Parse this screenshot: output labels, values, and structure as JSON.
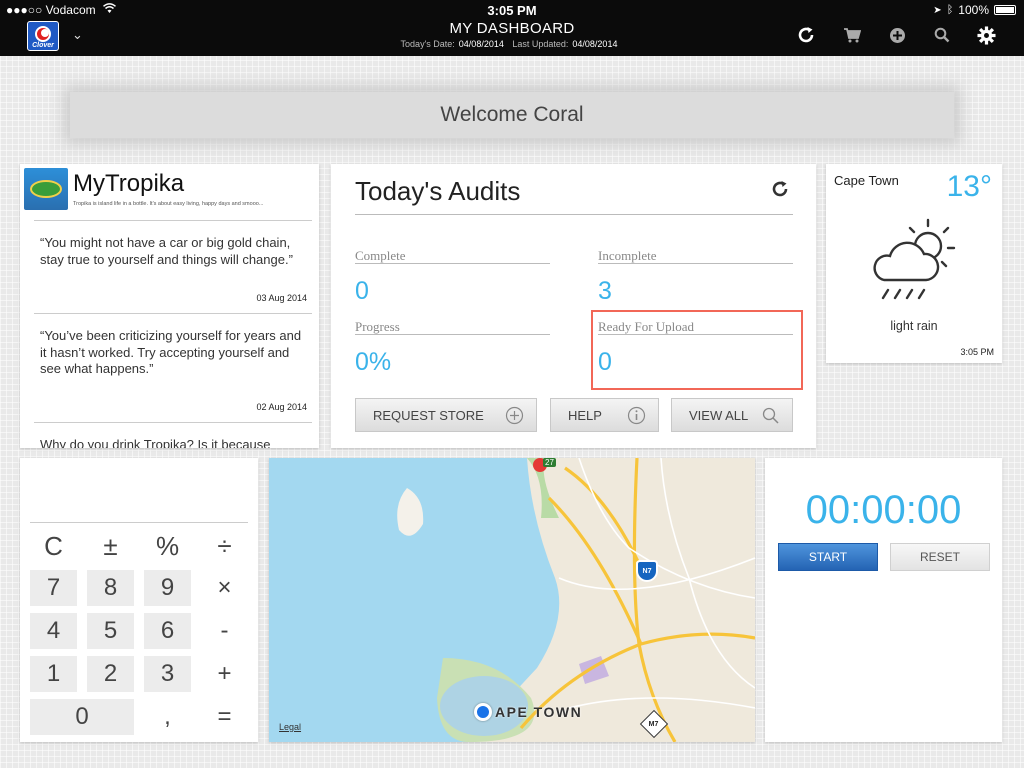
{
  "status_bar": {
    "carrier": "●●●○○ Vodacom",
    "time": "3:05 PM",
    "battery": "100%"
  },
  "nav": {
    "logo_text": "Clover",
    "title": "MY DASHBOARD",
    "todays_date_label": "Today's Date:",
    "todays_date": "04/08/2014",
    "last_updated_label": "Last Updated:",
    "last_updated": "04/08/2014",
    "icons": [
      "refresh-icon",
      "cart-icon",
      "plus-icon",
      "search-icon",
      "gear-icon"
    ]
  },
  "welcome": "Welcome Coral",
  "mytropika": {
    "title": "MyTropika",
    "tagline": "Tropika is island life in a bottle. It's about easy living, happy days and smooo...",
    "posts": [
      {
        "text": "“You might not have a car or big gold chain, stay true to yourself and things will change.”",
        "date": "03 Aug 2014"
      },
      {
        "text": "“You’ve been criticizing yourself for years and it hasn’t worked. Try accepting yourself and see what happens.”",
        "date": "02 Aug 2014"
      },
      {
        "text": "Why do you drink Tropika? Is it because",
        "date": ""
      }
    ]
  },
  "audits": {
    "title": "Today's Audits",
    "complete_label": "Complete",
    "complete": "0",
    "incomplete_label": "Incomplete",
    "incomplete": "3",
    "progress_label": "Progress",
    "progress": "0%",
    "ready_label": "Ready For Upload",
    "ready": "0",
    "buttons": {
      "request_store": "REQUEST STORE",
      "help": "HELP",
      "view_all": "VIEW ALL"
    }
  },
  "weather": {
    "city": "Cape Town",
    "temp": "13°",
    "desc": "light rain",
    "time": "3:05 PM"
  },
  "calculator": {
    "keys": [
      [
        "C",
        "±",
        "%",
        "÷"
      ],
      [
        "7",
        "8",
        "9",
        "×"
      ],
      [
        "4",
        "5",
        "6",
        "-"
      ],
      [
        "1",
        "2",
        "3",
        "+"
      ],
      [
        "0",
        ",",
        "="
      ]
    ]
  },
  "map": {
    "city_label": "APE TOWN",
    "legal": "Legal",
    "shield_n7": "N7",
    "shield_m7": "M7",
    "marker": "27"
  },
  "stopwatch": {
    "time": "00:00:00",
    "start": "START",
    "reset": "RESET"
  },
  "colors": {
    "accent": "#3ab3ea",
    "highlight": "#f26757",
    "start": "#2c74c4"
  }
}
